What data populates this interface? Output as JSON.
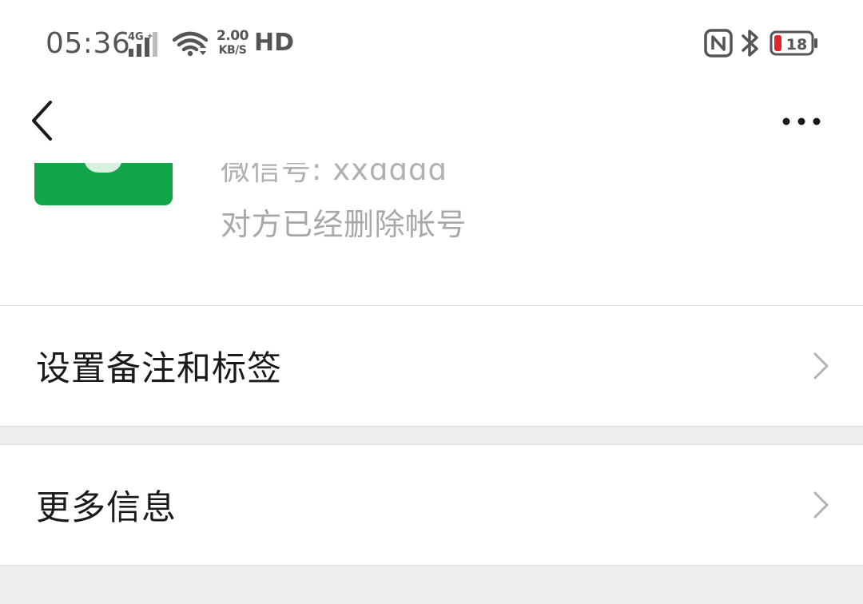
{
  "status_bar": {
    "time": "05:36",
    "network_type": "4G",
    "net_speed_value": "2.00",
    "net_speed_unit": "KB/S",
    "hd_label": "HD",
    "battery_level": "18",
    "battery_color": "#e8212a",
    "icons": {
      "signal": "signal-icon",
      "wifi": "wifi-icon",
      "nfc": "nfc-icon",
      "bluetooth": "bluetooth-icon",
      "battery": "battery-icon"
    }
  },
  "nav": {
    "back_icon": "back-chevron-icon",
    "more_icon": "more-dots-icon"
  },
  "profile": {
    "avatar_color": "#11a64a",
    "wechat_id_partial": "微信号: xxdddd",
    "status_text": "对方已经删除帐号"
  },
  "menu": {
    "items": [
      {
        "label": "设置备注和标签",
        "icon": "chevron-right-icon"
      },
      {
        "label": "更多信息",
        "icon": "chevron-right-icon"
      }
    ]
  },
  "colors": {
    "background": "#ededed",
    "card": "#ffffff",
    "primary_text": "#1a1a1a",
    "secondary_text": "#a8a8a8",
    "chevron": "#b2b2b2"
  }
}
